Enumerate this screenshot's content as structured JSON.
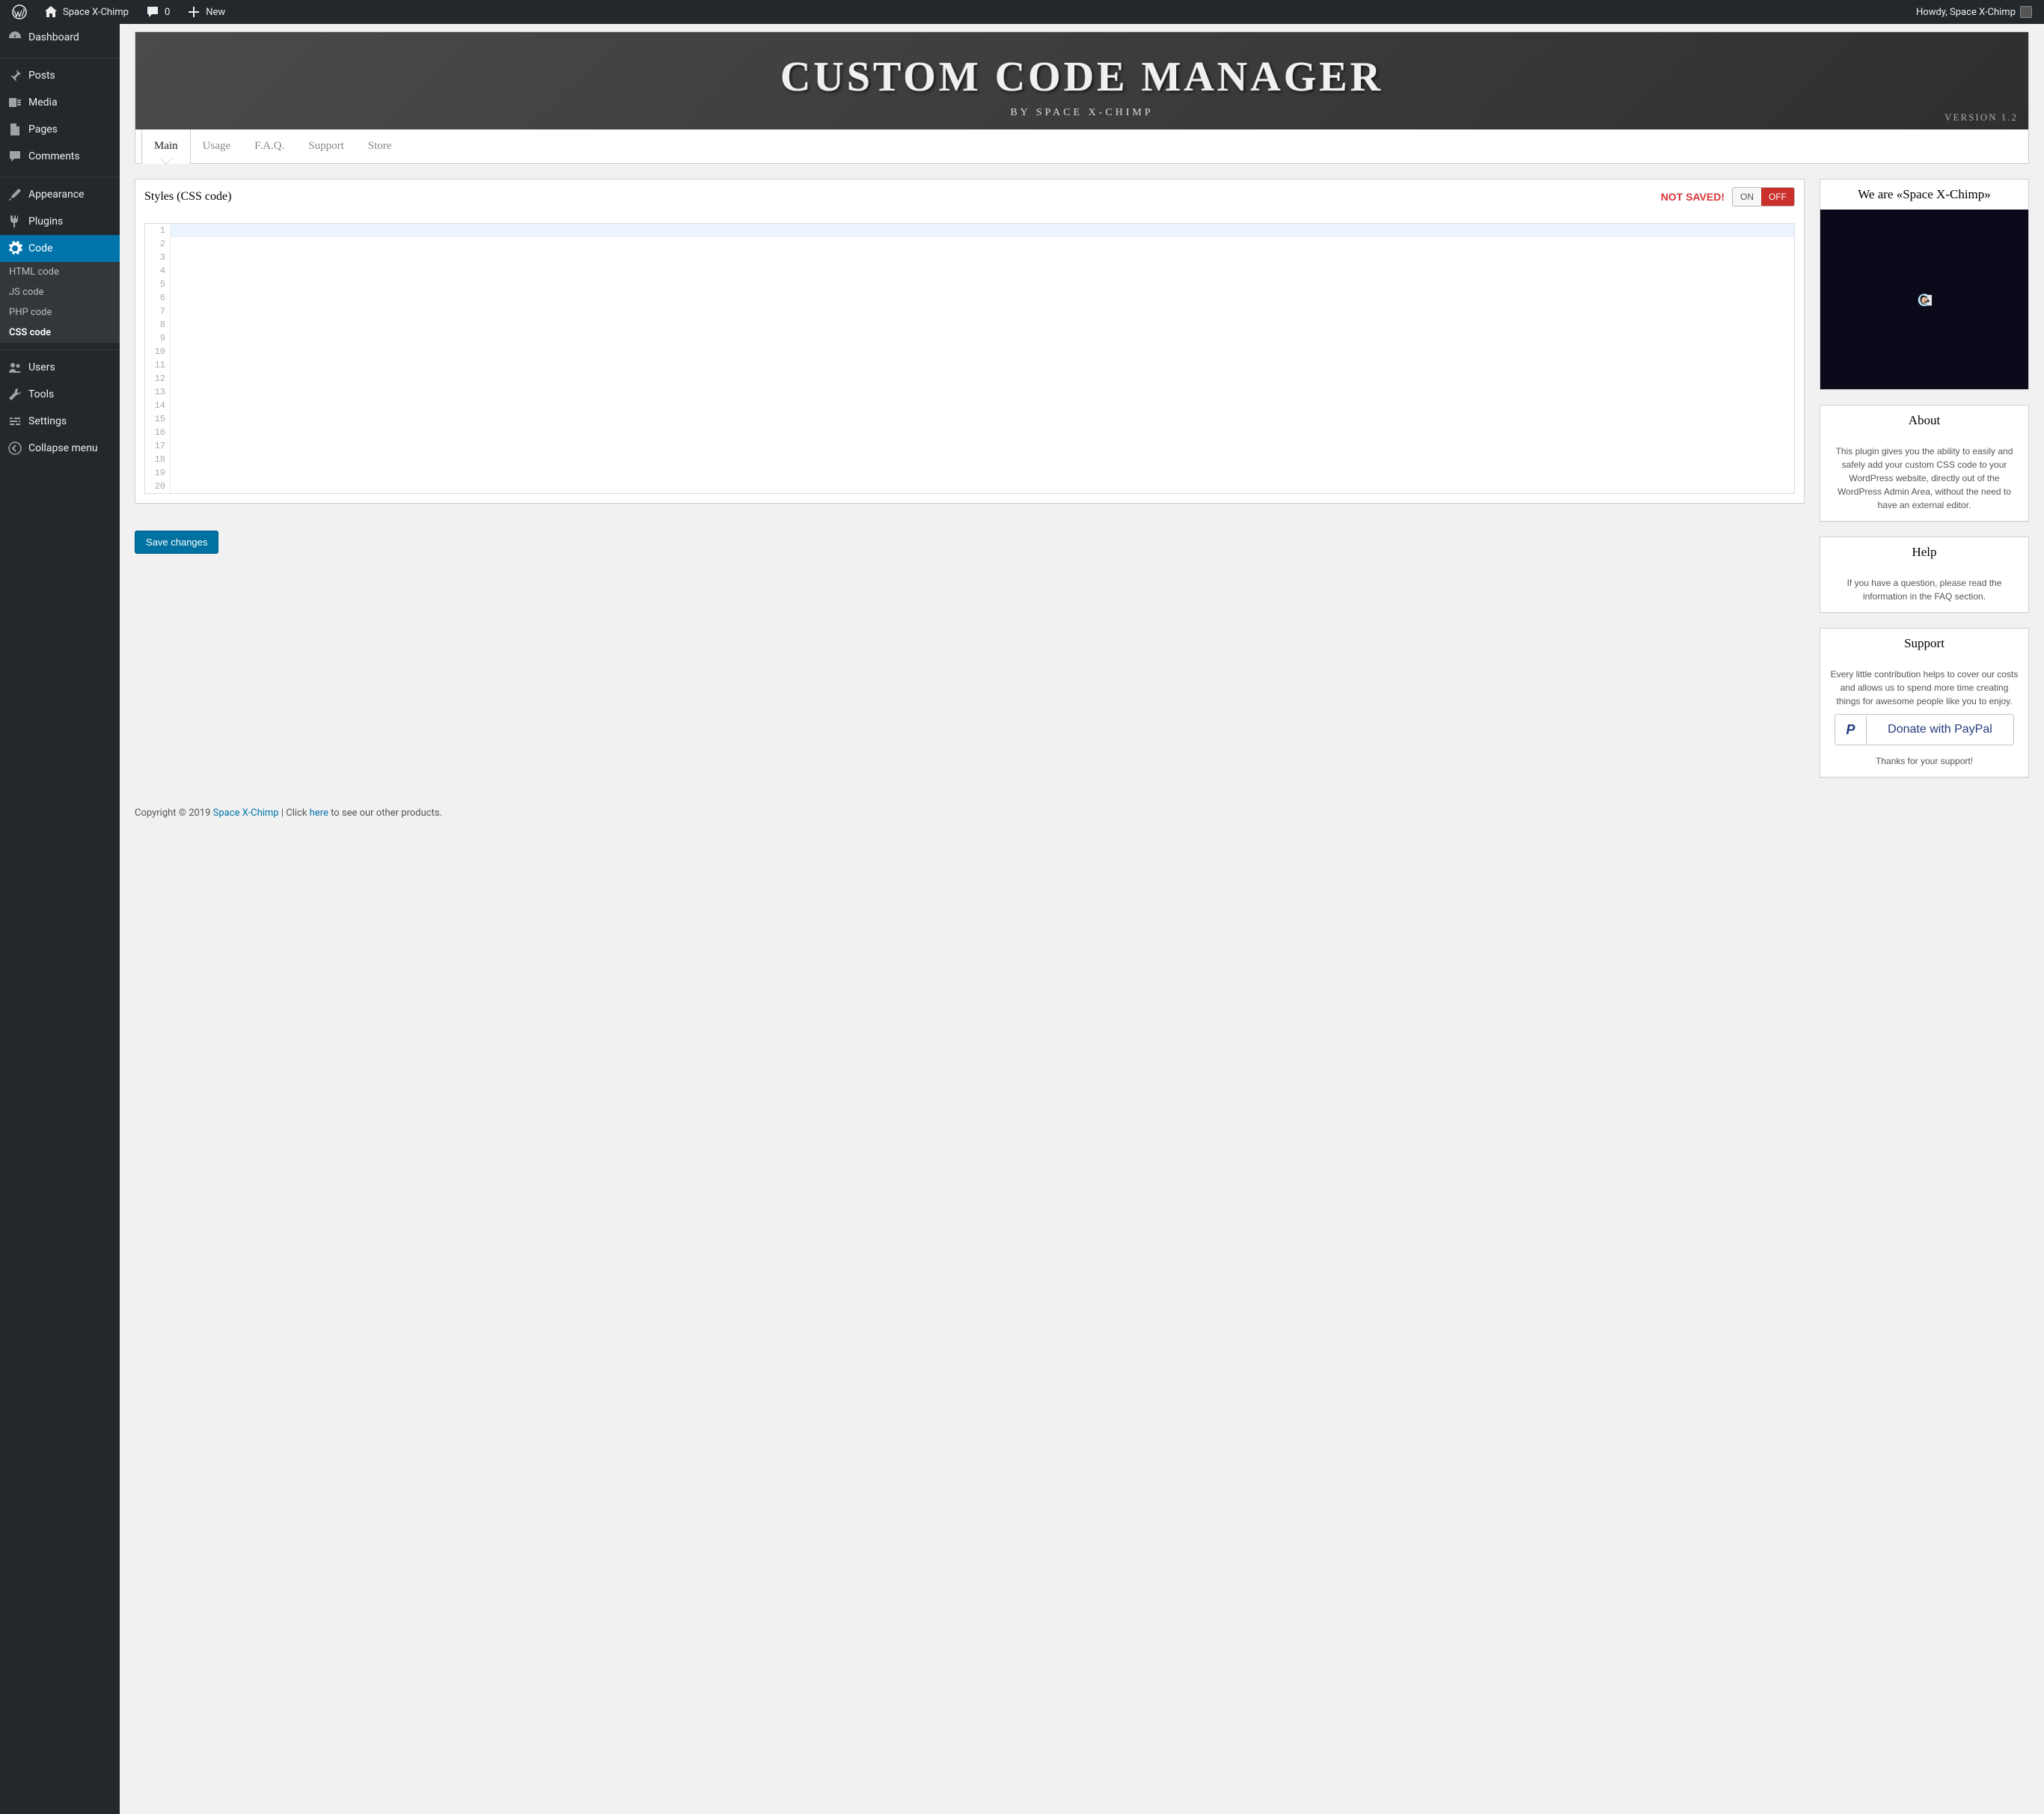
{
  "adminbar": {
    "site_name": "Space X-Chimp",
    "comments_count": "0",
    "new_label": "New",
    "howdy": "Howdy, Space X-Chimp"
  },
  "sidebar": {
    "items": [
      {
        "label": "Dashboard",
        "icon": "dashboard"
      },
      {
        "label": "Posts",
        "icon": "pin"
      },
      {
        "label": "Media",
        "icon": "media"
      },
      {
        "label": "Pages",
        "icon": "page"
      },
      {
        "label": "Comments",
        "icon": "comment"
      },
      {
        "label": "Appearance",
        "icon": "brush"
      },
      {
        "label": "Plugins",
        "icon": "plug"
      },
      {
        "label": "Code",
        "icon": "gear",
        "current": true
      },
      {
        "label": "Users",
        "icon": "users"
      },
      {
        "label": "Tools",
        "icon": "wrench"
      },
      {
        "label": "Settings",
        "icon": "sliders"
      },
      {
        "label": "Collapse menu",
        "icon": "collapse"
      }
    ],
    "submenu": [
      {
        "label": "HTML code"
      },
      {
        "label": "JS code"
      },
      {
        "label": "PHP code"
      },
      {
        "label": "CSS code",
        "current": true
      }
    ]
  },
  "banner": {
    "title": "CUSTOM CODE MANAGER",
    "subtitle": "BY SPACE X-CHIMP",
    "version": "VERSION 1.2"
  },
  "tabs": [
    {
      "label": "Main",
      "active": true
    },
    {
      "label": "Usage"
    },
    {
      "label": "F.A.Q."
    },
    {
      "label": "Support"
    },
    {
      "label": "Store"
    }
  ],
  "main": {
    "panel_title": "Styles (CSS code)",
    "not_saved": "NOT SAVED!",
    "toggle_on": "ON",
    "toggle_off": "OFF",
    "editor_lines": 20,
    "save_button": "Save changes"
  },
  "side": {
    "weare_title": "We are «Space X-Chimp»",
    "about_title": "About",
    "about_text": "This plugin gives you the ability to easily and safely add your custom CSS code to your WordPress website, directly out of the WordPress Admin Area, without the need to have an external editor.",
    "help_title": "Help",
    "help_text": "If you have a question, please read the information in the FAQ section.",
    "support_title": "Support",
    "support_text": "Every little contribution helps to cover our costs and allows us to spend more time creating things for awesome people like you to enjoy.",
    "donate_label": "Donate with PayPal",
    "thanks": "Thanks for your support!"
  },
  "footer": {
    "prefix": "Copyright © 2019 ",
    "link1": "Space X-Chimp",
    "middle": " | Click ",
    "link2": "here",
    "suffix": " to see our other products."
  }
}
